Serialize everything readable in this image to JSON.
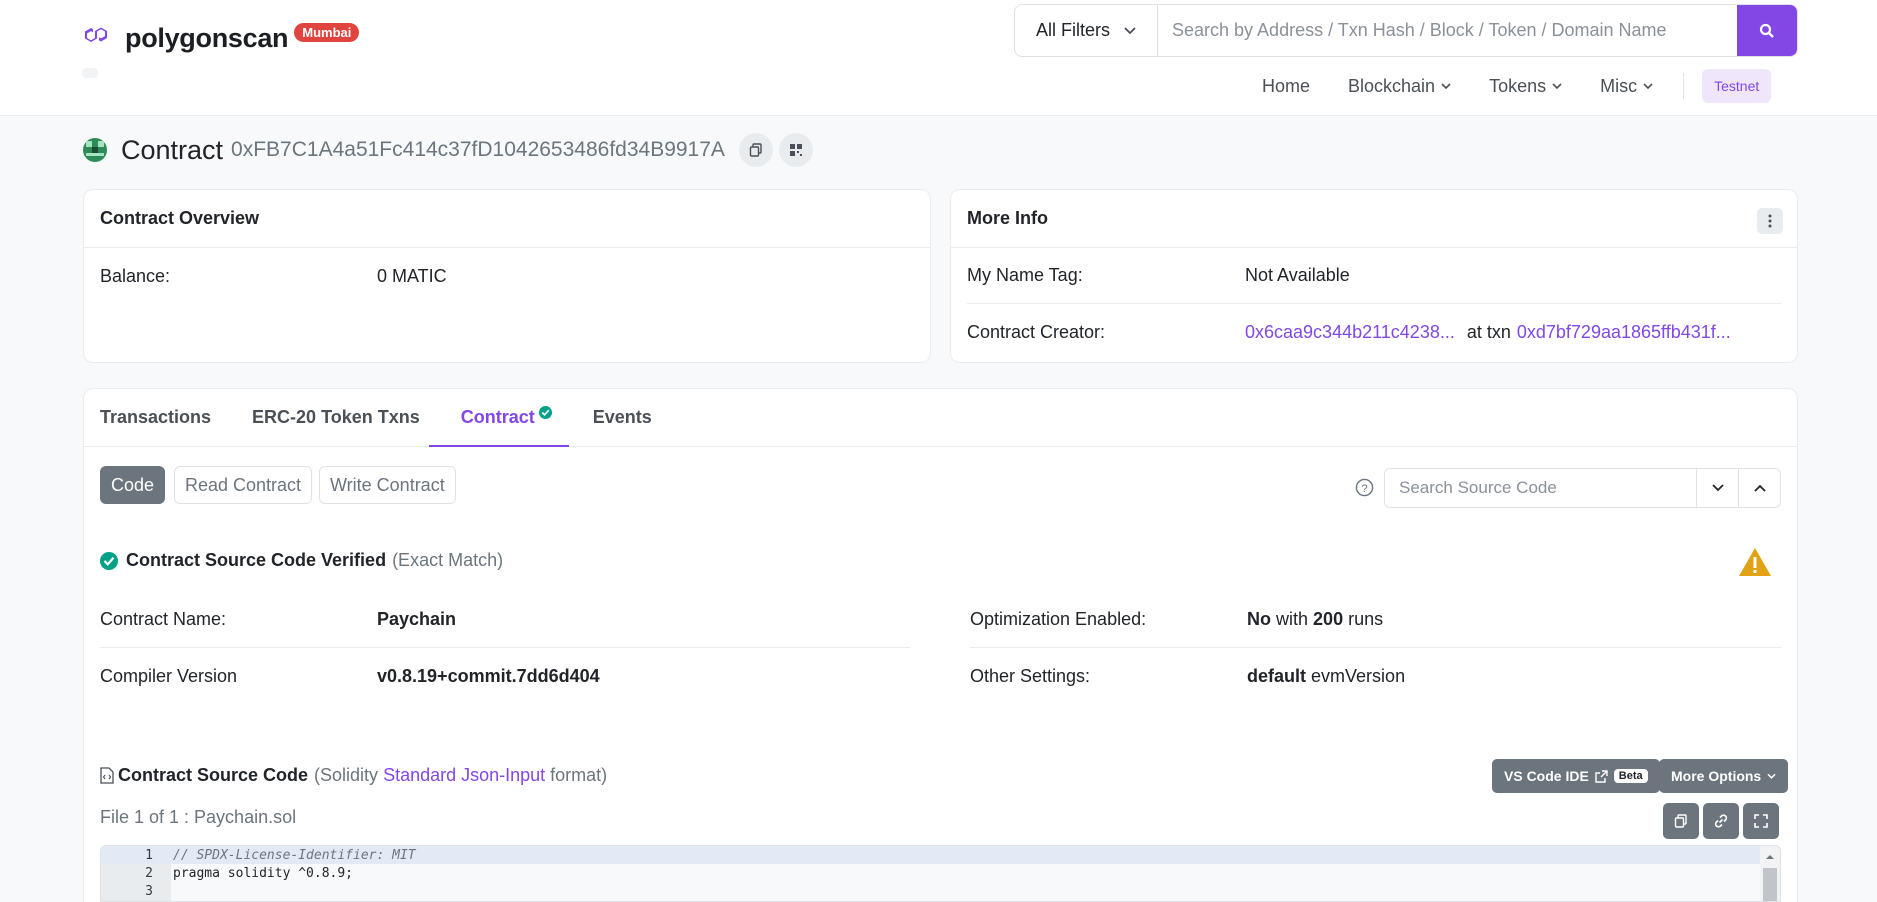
{
  "brand": {
    "name": "polygonscan",
    "network_badge": "Mumbai"
  },
  "search": {
    "filter_label": "All Filters",
    "placeholder": "Search by Address / Txn Hash / Block / Token / Domain Name"
  },
  "nav": {
    "items": [
      {
        "label": "Home"
      },
      {
        "label": "Blockchain"
      },
      {
        "label": "Tokens"
      },
      {
        "label": "Misc"
      }
    ],
    "network_button": "Testnet"
  },
  "page": {
    "title_label": "Contract",
    "address": "0xFB7C1A4a51Fc414c37fD1042653486fd34B9917A"
  },
  "overview": {
    "title": "Contract Overview",
    "balance_label": "Balance:",
    "balance_value": "0 MATIC"
  },
  "more_info": {
    "title": "More Info",
    "name_tag_label": "My Name Tag:",
    "name_tag_value": "Not Available",
    "creator_label": "Contract Creator:",
    "creator_address": "0x6caa9c344b211c4238...",
    "at_txn": "at txn",
    "creator_txn": "0xd7bf729aa1865ffb431f..."
  },
  "tabs": [
    {
      "label": "Transactions"
    },
    {
      "label": "ERC-20 Token Txns"
    },
    {
      "label": "Contract"
    },
    {
      "label": "Events"
    }
  ],
  "contract_subtabs": {
    "code": "Code",
    "read": "Read Contract",
    "write": "Write Contract",
    "source_search_placeholder": "Search Source Code"
  },
  "verification": {
    "title": "Contract Source Code Verified",
    "match": "(Exact Match)"
  },
  "details": {
    "name_label": "Contract Name:",
    "name_value": "Paychain",
    "compiler_label": "Compiler Version",
    "compiler_value": "v0.8.19+commit.7dd6d404",
    "optimization_label": "Optimization Enabled:",
    "optimization_value": "No",
    "optimization_with": "with",
    "optimization_runs": "200",
    "optimization_runs_word": "runs",
    "settings_label": "Other Settings:",
    "settings_value": "default",
    "settings_suffix": "evmVersion"
  },
  "source": {
    "title": "Contract Source Code",
    "format_prefix": "(Solidity",
    "format_link": "Standard Json-Input",
    "format_suffix": "format)",
    "file_label": "File 1 of 1 : Paychain.sol",
    "vscode_label": "VS Code IDE",
    "beta": "Beta",
    "more_options": "More Options",
    "lines": [
      {
        "n": "1",
        "text": "// SPDX-License-Identifier: MIT"
      },
      {
        "n": "2",
        "text": "pragma solidity ^0.8.9;"
      },
      {
        "n": "3",
        "text": ""
      }
    ]
  },
  "colors": {
    "accent": "#8247e5",
    "verified": "#00a186",
    "warning": "#e1a315"
  }
}
